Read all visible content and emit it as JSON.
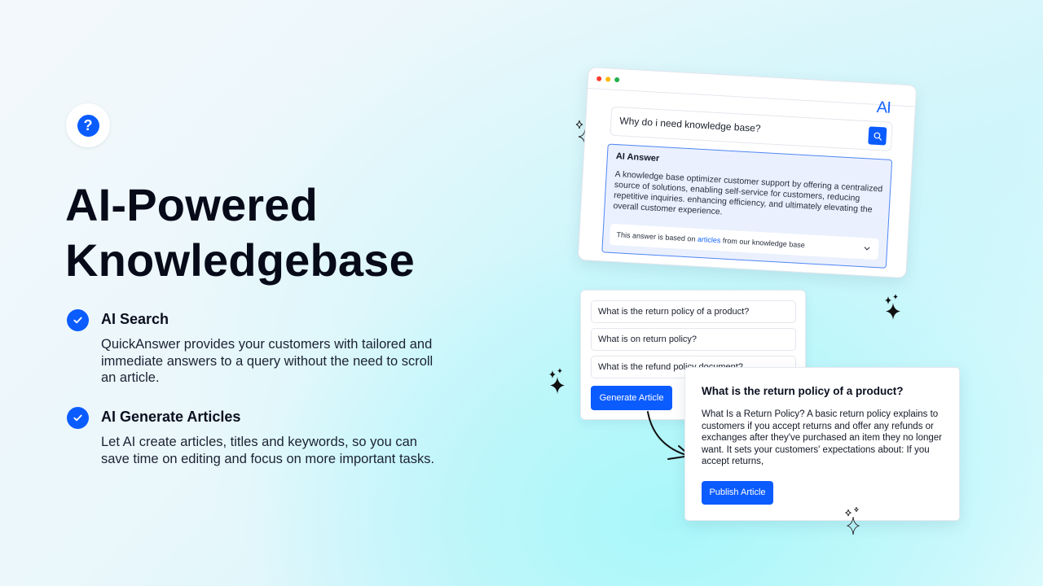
{
  "hero": {
    "icon": "question-circle-icon",
    "title_line1": "AI-Powered",
    "title_line2": "Knowledgebase"
  },
  "features": [
    {
      "icon": "check-circle-icon",
      "title": "AI Search",
      "description": "QuickAnswer provides your customers with tailored and immediate answers to a query without the need to scroll an article."
    },
    {
      "icon": "check-circle-icon",
      "title": "AI Generate Articles",
      "description": "Let AI create articles, titles and keywords, so you can save time on editing and focus on more important tasks."
    }
  ],
  "browser_mock": {
    "window_dots": [
      "#ff3b30",
      "#ffb800",
      "#22b14c"
    ],
    "logo": "AI",
    "search_query": "Why do i need knowledge base?",
    "search_icon": "search-icon",
    "answer_title": "AI Answer",
    "answer_body": "A knowledge base optimizer customer support by offering a centralized source of solutions, enabling self-service for customers, reducing repetitive inquiries. enhancing efficiency, and ultimately elevating the overall customer experience.",
    "source_prefix": "This answer is based on ",
    "source_link": "articles",
    "source_suffix": " from our knowledge base",
    "expand_icon": "chevron-down-icon"
  },
  "suggestions": {
    "options": [
      "What is the return policy of a product?",
      "What is on return policy?",
      "What is the refund policy document?"
    ],
    "generate_button": "Generate Article"
  },
  "article": {
    "title": "What is the return policy of a product?",
    "body": "What Is a Return Policy? A basic return policy explains to customers if you accept returns and offer any refunds or exchanges after they've purchased an item they no longer want. It sets your customers' expectations about: If you accept returns,",
    "publish_button": "Publish Article"
  },
  "colors": {
    "accent": "#0b5cff",
    "answer_bg": "#eaf0fd",
    "answer_border": "#4f86f7",
    "link": "#1566ff"
  }
}
